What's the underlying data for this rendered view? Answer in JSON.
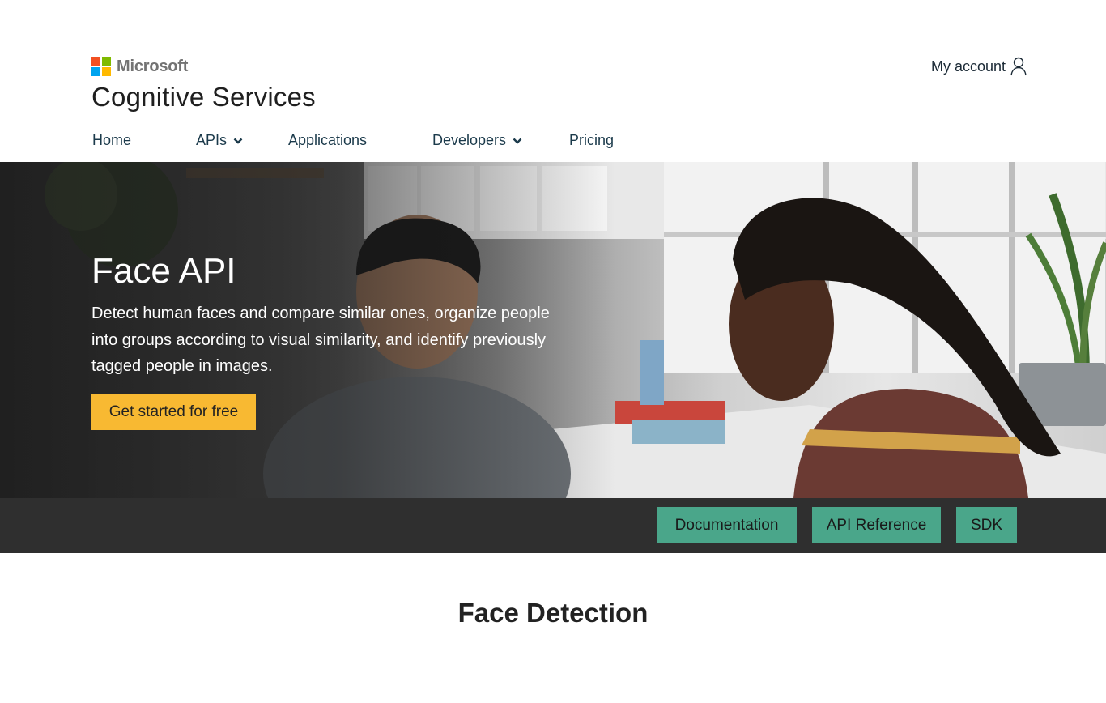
{
  "header": {
    "brand": "Microsoft",
    "product": "Cognitive Services",
    "account_label": "My account"
  },
  "nav": {
    "items": [
      {
        "label": "Home",
        "has_dropdown": false
      },
      {
        "label": "APIs",
        "has_dropdown": true
      },
      {
        "label": "Applications",
        "has_dropdown": false
      },
      {
        "label": "Developers",
        "has_dropdown": true
      },
      {
        "label": "Pricing",
        "has_dropdown": false
      }
    ]
  },
  "hero": {
    "title": "Face API",
    "description": "Detect human faces and compare similar ones, organize people into groups according to visual similarity, and identify previously tagged people in images.",
    "cta_label": "Get started for free"
  },
  "resources": {
    "documentation": "Documentation",
    "api_reference": "API Reference",
    "sdk": "SDK"
  },
  "section": {
    "title": "Face Detection"
  },
  "colors": {
    "cta": "#f8b932",
    "resource_button": "#4aa68a",
    "bar": "#2f2f2f"
  },
  "icons": [
    "microsoft-logo-icon",
    "user-icon",
    "chevron-down-icon"
  ]
}
